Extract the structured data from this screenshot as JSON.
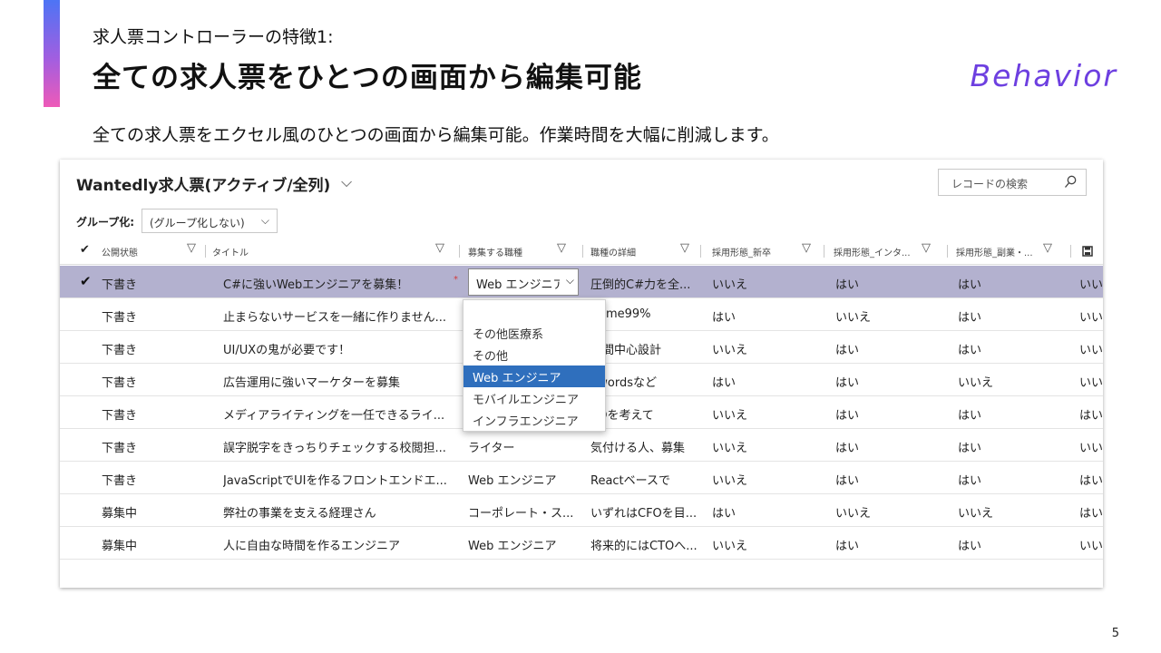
{
  "slide": {
    "subtitle": "求人票コントローラーの特徴1:",
    "title": "全ての求人票をひとつの画面から編集可能",
    "brand": "Behavior",
    "description": "全ての求人票をエクセル風のひとつの画面から編集可能。作業時間を大幅に削減します。",
    "page_number": "5"
  },
  "grid": {
    "view_title": "Wantedly求人票(アクティブ/全列)",
    "view_chevron": "⌵",
    "search_placeholder": "レコードの検索",
    "group_label": "グループ化:",
    "group_value": "(グループ化しない)",
    "group_chevron": "⌵",
    "header_check": "✔",
    "columns": [
      {
        "label": "公開状態"
      },
      {
        "label": "タイトル"
      },
      {
        "label": "募集する職種"
      },
      {
        "label": "職種の詳細"
      },
      {
        "label": "採用形態_新卒"
      },
      {
        "label": "採用形態_インタ..."
      },
      {
        "label": "採用形態_副業・..."
      }
    ],
    "filter_icon": "▽",
    "rows": [
      {
        "status": "下書き",
        "title": "C#に強いWebエンジニアを募集！",
        "job": "Web エンジニア",
        "detail": "圧倒的C#力を全...",
        "shinsotsu": "いいえ",
        "intern": "はい",
        "fukugyo": "はい",
        "extra": "いい",
        "selected": true
      },
      {
        "status": "下書き",
        "title": "止まらないサービスを一緒に作りません...",
        "job": "",
        "detail": "ptime99%",
        "shinsotsu": "はい",
        "intern": "いいえ",
        "fukugyo": "はい",
        "extra": "いい"
      },
      {
        "status": "下書き",
        "title": "UI/UXの鬼が必要です！",
        "job": "",
        "detail": "人間中心設計",
        "shinsotsu": "いいえ",
        "intern": "はい",
        "fukugyo": "はい",
        "extra": "いい"
      },
      {
        "status": "下書き",
        "title": "広告運用に強いマーケターを募集",
        "job": "",
        "detail": "dwordsなど",
        "shinsotsu": "はい",
        "intern": "はい",
        "fukugyo": "いいえ",
        "extra": "いい"
      },
      {
        "status": "下書き",
        "title": "メディアライティングを一任できるライ...",
        "job": "",
        "detail": "EOを考えて",
        "shinsotsu": "いいえ",
        "intern": "はい",
        "fukugyo": "はい",
        "extra": "はい"
      },
      {
        "status": "下書き",
        "title": "誤字脱字をきっちりチェックする校閲担...",
        "job": "ライター",
        "detail": "気付ける人、募集",
        "shinsotsu": "いいえ",
        "intern": "はい",
        "fukugyo": "はい",
        "extra": "いい"
      },
      {
        "status": "下書き",
        "title": "JavaScriptでUIを作るフロントエンドエ...",
        "job": "Web エンジニア",
        "detail": "Reactベースで",
        "shinsotsu": "いいえ",
        "intern": "はい",
        "fukugyo": "はい",
        "extra": "はい"
      },
      {
        "status": "募集中",
        "title": "弊社の事業を支える経理さん",
        "job": "コーポレート・ス...",
        "detail": "いずれはCFOを目...",
        "shinsotsu": "はい",
        "intern": "いいえ",
        "fukugyo": "いいえ",
        "extra": "はい"
      },
      {
        "status": "募集中",
        "title": "人に自由な時間を作るエンジニア",
        "job": "Web エンジニア",
        "detail": "将来的にはCTOへ...",
        "shinsotsu": "いいえ",
        "intern": "はい",
        "fukugyo": "はい",
        "extra": "いい"
      }
    ],
    "row_check": "✔",
    "required_marker": "*",
    "editor": {
      "value": "Web エンジニア",
      "chevron": "⌵"
    },
    "dropdown": {
      "options": [
        "その他医療系",
        "その他",
        "Web エンジニア",
        "モバイルエンジニア",
        "インフラエンジニア"
      ],
      "selected": "Web エンジニア"
    }
  },
  "colors": {
    "accent_gradient": [
      "#4d74f5",
      "#a25ee0",
      "#ee5ab8"
    ],
    "brand": "#6d3fe0",
    "selected_row": "#b3b1cf",
    "dropdown_active": "#2f6fbd"
  }
}
